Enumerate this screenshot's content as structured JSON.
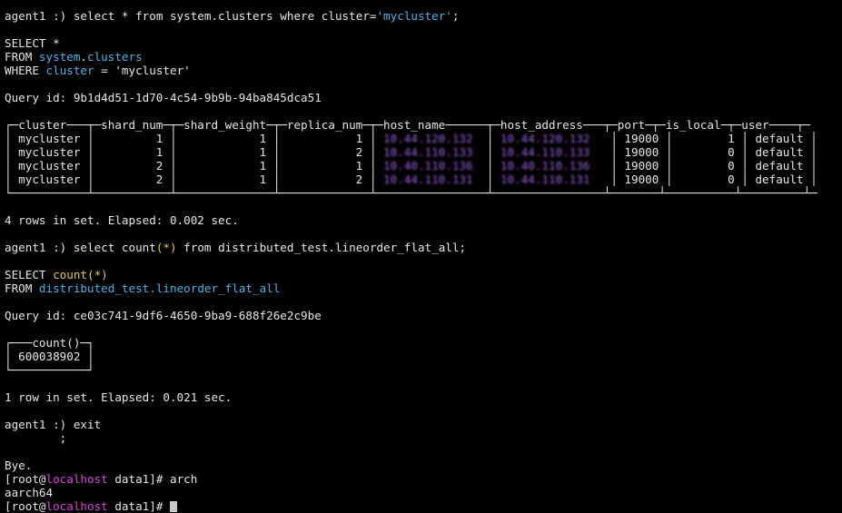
{
  "colors": {
    "background": "#000000",
    "text": "#e6e6e6",
    "identifier": "#4fb3e8",
    "function": "#e6c84a",
    "hostname": "#e040e0",
    "redacted": "#b070ff"
  },
  "block1": {
    "prompt": "agent1 :) ",
    "command": "select * from system.clusters where cluster=",
    "literal": "'mycluster'",
    "terminator": ";",
    "fmt_select": "SELECT *",
    "fmt_from_kw": "FROM ",
    "fmt_from_db": "system",
    "fmt_dot": ".",
    "fmt_from_tbl": "clusters",
    "fmt_where_kw": "WHERE ",
    "fmt_where_col": "cluster",
    "fmt_where_rest": " = 'mycluster'",
    "query_id": "Query id: 9b1d4d51-1d70-4c54-9b9b-94ba845dca51",
    "table": {
      "top_border": "┌─cluster───┬─shard_num─┬─shard_weight─┬─replica_num─┬─host_name──────┬─host_address───┬─port─┬─is_local─┬─user────┬─",
      "rows": [
        {
          "lead": "│ mycluster │         1 │            1 │           1 │ ",
          "host_name": "10.44.120.132 ",
          "mid": " │ ",
          "host_address": "10.44.120.132  ",
          "tail": " │ 19000 │        1 │ default │ "
        },
        {
          "lead": "│ mycluster │         1 │            1 │           2 │ ",
          "host_name": "10.44.110.133 ",
          "mid": " │ ",
          "host_address": "10.44.110.133  ",
          "tail": " │ 19000 │        0 │ default │ "
        },
        {
          "lead": "│ mycluster │         2 │            1 │           1 │ ",
          "host_name": "10.40.110.136 ",
          "mid": " │ ",
          "host_address": "10.40.110.136  ",
          "tail": " │ 19000 │        0 │ default │ "
        },
        {
          "lead": "│ mycluster │         2 │            1 │           2 │ ",
          "host_name": "10.44.110.131 ",
          "mid": " │ ",
          "host_address": "10.44.110.131  ",
          "tail": " │ 19000 │        0 │ default │ "
        }
      ],
      "bottom_border": "└───────────┴───────────┴──────────────┴─────────────┴────────────────┴────────────────┴───────┴──────────┴─────────┴─"
    },
    "result": "4 rows in set. Elapsed: 0.002 sec."
  },
  "block2": {
    "prompt": "agent1 :) ",
    "command_pre": "select count",
    "command_args": "(*)",
    "command_post": " from distributed_test.lineorder_flat_all;",
    "fmt_select_kw": "SELECT ",
    "fmt_count": "count(*)",
    "fmt_from_kw": "FROM ",
    "fmt_from_db": "distributed_test",
    "fmt_dot": ".",
    "fmt_from_tbl": "lineorder_flat_all",
    "query_id": "Query id: ce03c741-9df6-4650-9ba9-688f26e2c9be",
    "table": {
      "top_border": "┌───count()─┐",
      "row": "│ 600038902 │",
      "bottom_border": "└───────────┘"
    },
    "result": "1 row in set. Elapsed: 0.021 sec."
  },
  "block3": {
    "prompt": "agent1 :) ",
    "command": "exit",
    "continuation": "        ;",
    "bye": "Bye."
  },
  "shell": {
    "open_bracket": "[root@",
    "hostname": "localhost",
    "dir_part": " data1]# ",
    "command1": "arch",
    "output1": "aarch64",
    "dir_part2": " data1]# "
  }
}
